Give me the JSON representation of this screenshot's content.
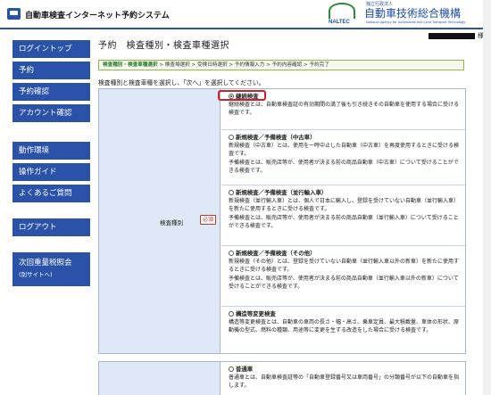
{
  "header": {
    "title": "自動車検査インターネット予約システム",
    "logo_sub": "独立行政法人",
    "logo_jp": "自動車技術総合機構",
    "logo_en": "NALTEC",
    "logo_tagline": "National Agency for Automobile and Land Transport Technology"
  },
  "user": {
    "suffix": "様"
  },
  "sidebar": {
    "items": [
      {
        "label": "ログイントップ"
      },
      {
        "label": "予約"
      },
      {
        "label": "予約確認"
      },
      {
        "label": "アカウント確認"
      },
      {
        "label": "動作環境"
      },
      {
        "label": "操作ガイド"
      },
      {
        "label": "よくあるご質問"
      },
      {
        "label": "ログアウト"
      },
      {
        "label": "次回重量税照会",
        "sub": "(別サイトへ)"
      }
    ]
  },
  "main": {
    "title": "予約　検査種別・検査車種選択",
    "breadcrumb": {
      "current": "検査種別・検査車種選択",
      "rest": " > 検査場選択 > 受検日時選択 > 予約情報入力 > 予約内容確認 > 予約完了"
    },
    "instruction": "検査種別と検査車種を選択し、「次へ」を選択してください。"
  },
  "form": {
    "label": "検査種別",
    "required": "必須",
    "options": [
      {
        "title": "継続検査",
        "checked": true,
        "desc": [
          "継続検査とは、自動車検査証の有効期間の満了後も引き続きその自動車を使用する場合に受ける検査です。"
        ]
      },
      {
        "title": "新規検査／予備検査（中古車）",
        "checked": false,
        "desc": [
          "新規検査（中古車）とは、使用を一時中止した自動車（中古車）を再度使用するときに受ける検査です。",
          "予備検査とは、販売店等が、使用者が決まる前の商品自動車（中古車）について受けることができる検査です。"
        ]
      },
      {
        "title": "新規検査／予備検査（並行輸入車）",
        "checked": false,
        "desc": [
          "新規検査（並行輸入車）とは、個人で日本に輸入し、登録を受けていない自動車（並行輸入車）を新たに使用するときに受ける検査です。",
          "予備検査とは、販売店等が、使用者が決まる前の商品自動車（並行輸入車）について受けることができる検査です。"
        ]
      },
      {
        "title": "新規検査／予備検査（その他）",
        "checked": false,
        "desc": [
          "新規検査（その他）とは、登録を受けていない自動車（並行輸入車以外の新車）を新たに使用するときに受ける検査です。",
          "予備検査とは、販売店等が、使用者が決まる前の商品自動車（並行輸入車以外の新車）について受けることができる検査です。"
        ]
      },
      {
        "title": "構造等変更検査",
        "checked": false,
        "desc": [
          "構造等変更検査とは、自動車の車両の長さ・幅・高さ、乗車定員、最大積載量、車体の形状、原動機の型式、燃料の種類、用途等に変更を生ずる改造をした場合に受ける検査です。"
        ]
      }
    ]
  },
  "form2": {
    "options": [
      {
        "title": "普通車",
        "desc": "普通車とは、自動車検査証等の「自動車登録番号又は車両番号」の分類番号が以下の自動車を指します。"
      }
    ]
  }
}
